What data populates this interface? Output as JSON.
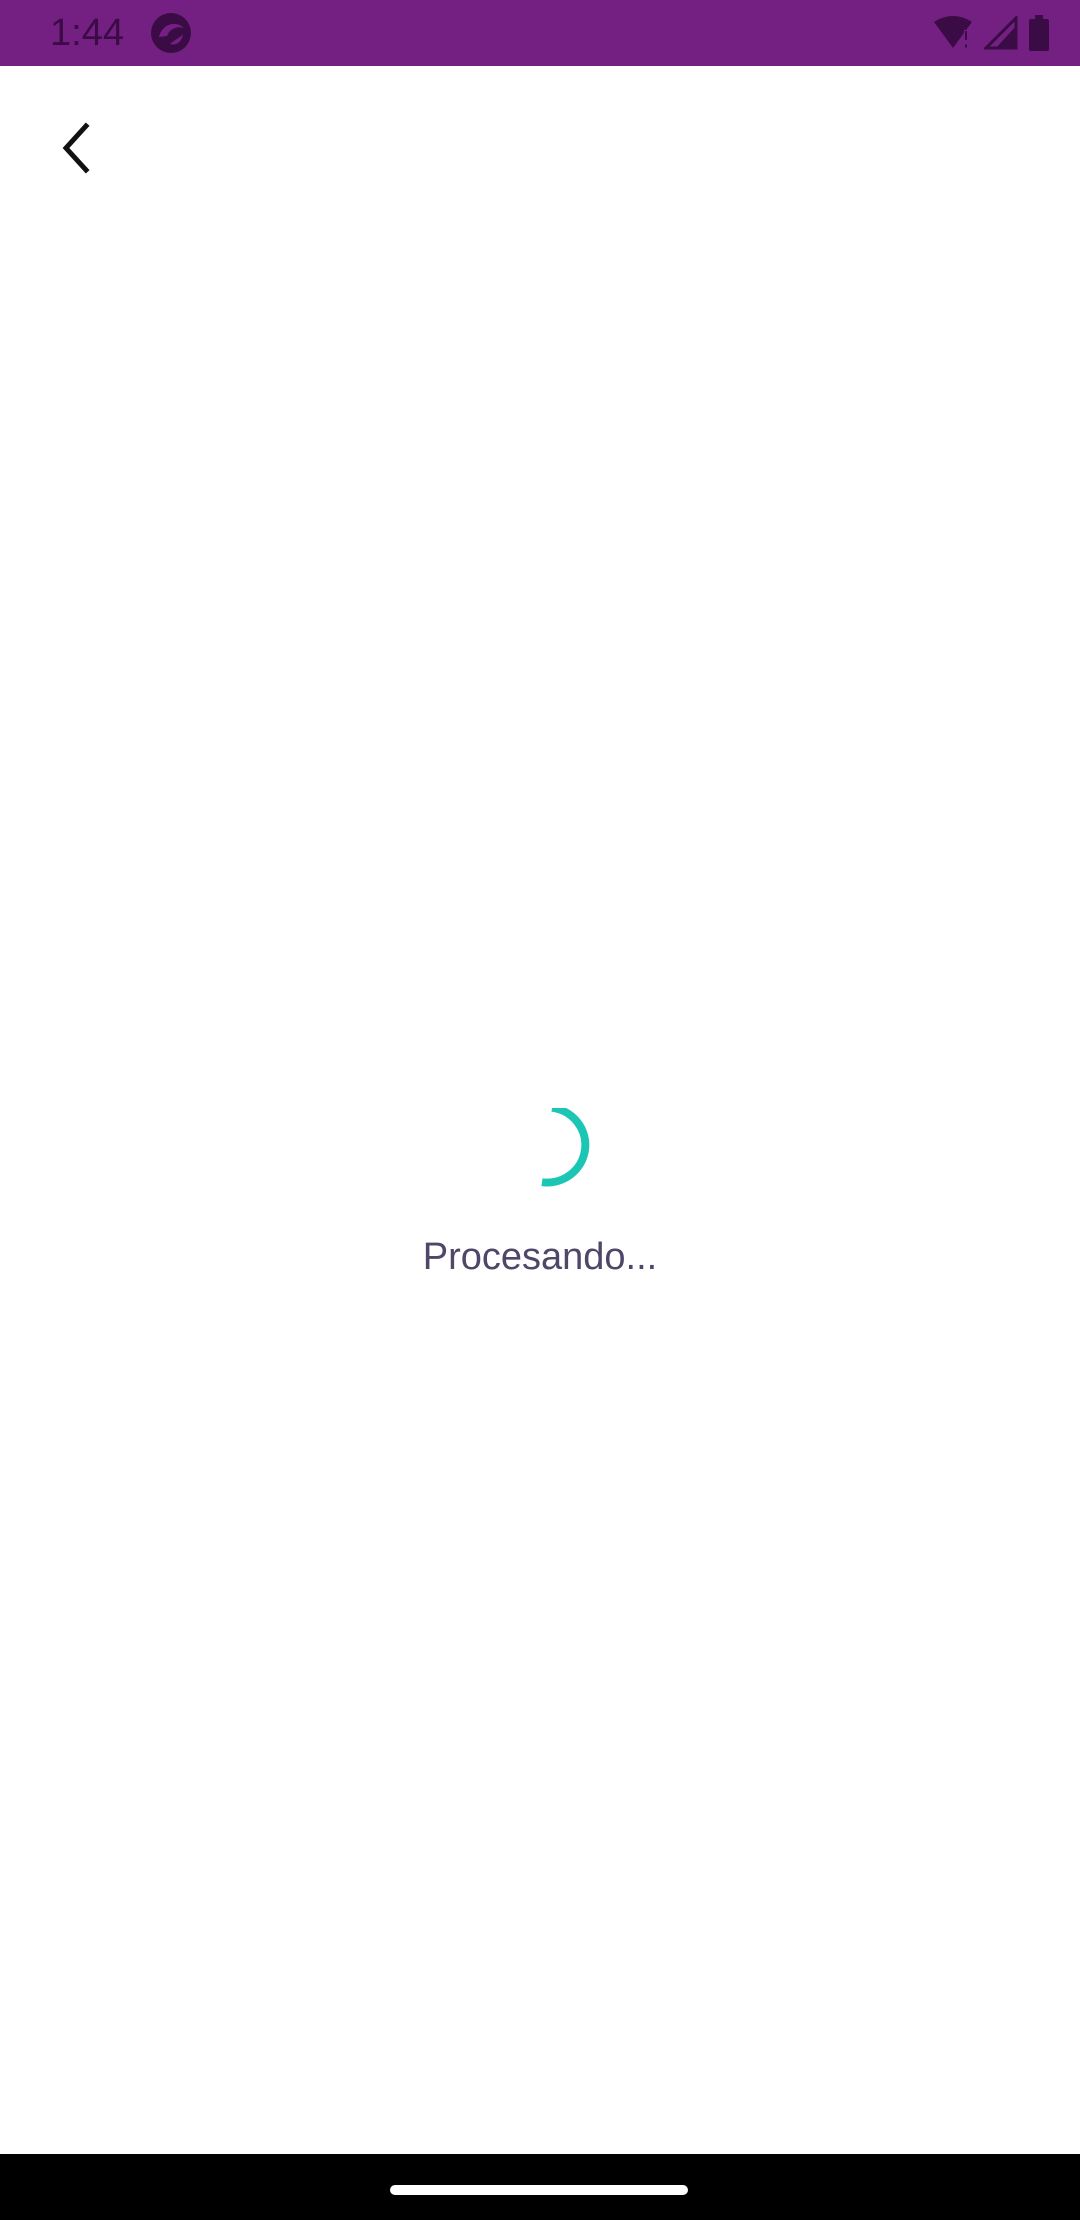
{
  "status_bar": {
    "time": "1:44",
    "background_color": "#742083",
    "icons": [
      "app-notification-icon",
      "wifi-alert-icon",
      "cell-signal-icon",
      "battery-icon"
    ]
  },
  "toolbar": {
    "back_icon": "chevron-left-icon"
  },
  "loading": {
    "message": "Procesando...",
    "spinner_color": "#1cc6b4",
    "text_color": "#4f4668"
  },
  "nav_bar": {
    "home_indicator": "home-pill"
  }
}
